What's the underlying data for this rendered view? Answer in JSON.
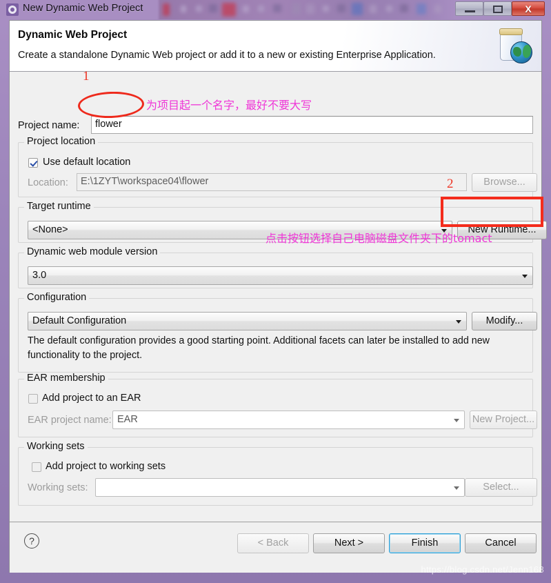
{
  "window": {
    "title": "New Dynamic Web Project",
    "icon": "eclipse-gear-icon",
    "minimize_label": "",
    "maximize_label": "",
    "close_label": "X"
  },
  "header": {
    "title": "Dynamic Web Project",
    "description": "Create a standalone Dynamic Web project or add it to a new or existing Enterprise Application.",
    "icon": "jar-globe-icon"
  },
  "form": {
    "project_name_label": "Project name:",
    "project_name_value": "flower",
    "project_location": {
      "group_title": "Project location",
      "use_default_label": "Use default location",
      "use_default_checked": true,
      "location_label": "Location:",
      "location_value": "E:\\1ZYT\\workspace04\\flower",
      "browse_label": "Browse..."
    },
    "target_runtime": {
      "group_title": "Target runtime",
      "selected": "<None>",
      "new_runtime_label": "New Runtime..."
    },
    "module_version": {
      "group_title": "Dynamic web module version",
      "selected": "3.0"
    },
    "configuration": {
      "group_title": "Configuration",
      "selected": "Default Configuration",
      "modify_label": "Modify...",
      "description": "The default configuration provides a good starting point. Additional facets can later be installed to add new functionality to the project."
    },
    "ear_membership": {
      "group_title": "EAR membership",
      "add_to_ear_label": "Add project to an EAR",
      "add_to_ear_checked": false,
      "ear_project_name_label": "EAR project name:",
      "ear_project_name_value": "EAR",
      "new_project_label": "New Project..."
    },
    "working_sets": {
      "group_title": "Working sets",
      "add_to_working_sets_label": "Add project to working sets",
      "add_to_working_sets_checked": false,
      "working_sets_label": "Working sets:",
      "working_sets_value": "",
      "select_label": "Select..."
    }
  },
  "buttonbar": {
    "help_glyph": "?",
    "back_label": "< Back",
    "next_label": "Next >",
    "finish_label": "Finish",
    "cancel_label": "Cancel"
  },
  "annotations": {
    "marker_one": "1",
    "marker_two": "2",
    "note_project_name": "为项目起一个名字，最好不要大写",
    "note_new_runtime": "点击按钮选择自己电脑磁盘文件夹下的tomact",
    "highlight_color": "#ee2a1c",
    "note_color": "#ef35d7"
  },
  "watermark": "https://blog.csdn.net/Jenn168"
}
